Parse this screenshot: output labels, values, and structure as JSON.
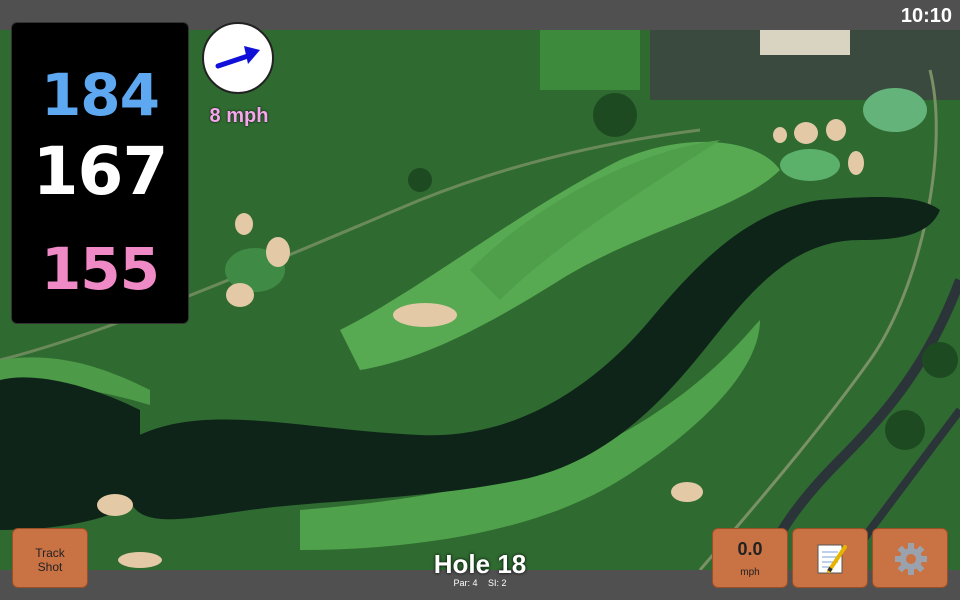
{
  "status_bar": {
    "time": "10:10"
  },
  "distances": {
    "back": "184",
    "middle": "167",
    "front": "155"
  },
  "wind": {
    "speed_label": "8 mph",
    "direction_icon": "arrow-icon"
  },
  "hole": {
    "title": "Hole 18",
    "par": "Par: 4",
    "stroke_index": "SI: 2"
  },
  "buttons": {
    "track_shot_line1": "Track",
    "track_shot_line2": "Shot",
    "speed_value": "0.0",
    "speed_unit": "mph",
    "notes_icon": "notepad-icon",
    "settings_icon": "gear-icon"
  },
  "colors": {
    "back_distance": "#5ea8f2",
    "middle_distance": "#ffffff",
    "front_distance": "#f08ac6",
    "wind_text": "#f7a6ee",
    "button": "#c97244"
  }
}
